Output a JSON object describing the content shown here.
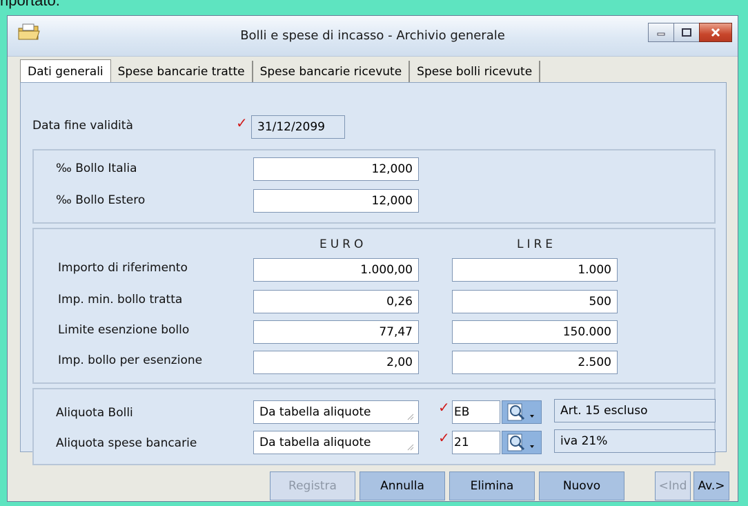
{
  "top_text": "riportato.",
  "window": {
    "title": "Bolli e spese di incasso - Archivio generale"
  },
  "tabs": [
    "Dati generali",
    "Spese bancarie tratte",
    "Spese bancarie ricevute",
    "Spese bolli ricevute"
  ],
  "validity": {
    "label": "Data fine validità",
    "value": "31/12/2099"
  },
  "stamp_rates": {
    "italia_label": "‰ Bollo Italia",
    "italia_value": "12,000",
    "estero_label": "‰ Bollo Estero",
    "estero_value": "12,000"
  },
  "amounts": {
    "euro_header": "EURO",
    "lire_header": "LIRE",
    "rows": [
      {
        "label": "Importo di riferimento",
        "euro": "1.000,00",
        "lire": "1.000"
      },
      {
        "label": "Imp. min. bollo tratta",
        "euro": "0,26",
        "lire": "500"
      },
      {
        "label": "Limite esenzione bollo",
        "euro": "77,47",
        "lire": "150.000"
      },
      {
        "label": "Imp. bollo per esenzione",
        "euro": "2,00",
        "lire": "2.500"
      }
    ]
  },
  "rates": {
    "bolli": {
      "label": "Aliquota Bolli",
      "source": "Da tabella aliquote",
      "code": "EB",
      "description": "Art. 15 escluso"
    },
    "spese": {
      "label": "Aliquota spese bancarie",
      "source": "Da tabella aliquote",
      "code": "21",
      "description": "iva 21%"
    }
  },
  "buttons": {
    "registra": "Registra",
    "annulla": "Annulla",
    "elimina": "Elimina",
    "nuovo": "Nuovo",
    "prev": "<Ind",
    "next": "Av.>"
  },
  "colors": {
    "window_bg": "#e9e9e2",
    "panel_bg": "#dbe6f3",
    "button_bg": "#a9c2e2",
    "check": "#d11a1a"
  }
}
